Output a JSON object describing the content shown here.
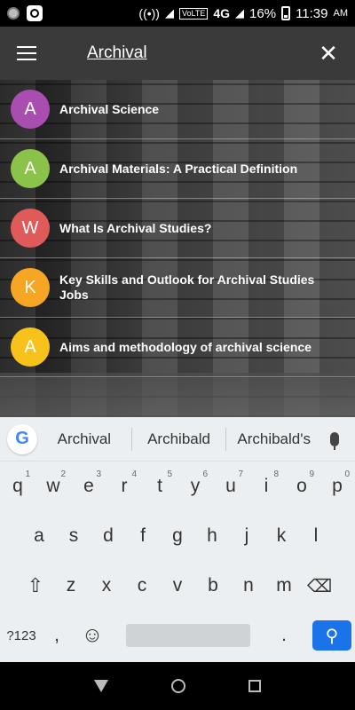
{
  "status_bar": {
    "volte": "VoLTE",
    "network": "4G",
    "network_sub": "4G",
    "battery": "16%",
    "time": "11:39",
    "ampm": "AM"
  },
  "toolbar": {
    "query": "Archival",
    "close_symbol": "✕",
    "menu_icon": "hamburger-icon"
  },
  "results": [
    {
      "letter": "A",
      "title": "Archival Science",
      "color": "#a94db0"
    },
    {
      "letter": "A",
      "title": "Archival Materials: A Practical Definition",
      "color": "#8bc34a"
    },
    {
      "letter": "W",
      "title": "What Is Archival Studies?",
      "color": "#e05a5a"
    },
    {
      "letter": "K",
      "title": "Key Skills and Outlook for Archival Studies Jobs",
      "color": "#f6a623"
    },
    {
      "letter": "A",
      "title": "Aims and methodology of archival science",
      "color": "#f7c31a"
    }
  ],
  "keyboard": {
    "google_letter": "G",
    "suggestions": [
      "Archival",
      "Archibald",
      "Archibald's"
    ],
    "row1": [
      [
        "q",
        "1"
      ],
      [
        "w",
        "2"
      ],
      [
        "e",
        "3"
      ],
      [
        "r",
        "4"
      ],
      [
        "t",
        "5"
      ],
      [
        "y",
        "6"
      ],
      [
        "u",
        "7"
      ],
      [
        "i",
        "8"
      ],
      [
        "o",
        "9"
      ],
      [
        "p",
        "0"
      ]
    ],
    "row2": [
      "a",
      "s",
      "d",
      "f",
      "g",
      "h",
      "j",
      "k",
      "l"
    ],
    "row3": [
      "z",
      "x",
      "c",
      "v",
      "b",
      "n",
      "m"
    ],
    "symbols_key": "?123",
    "comma": ",",
    "emoji": "☺",
    "period": ".",
    "shift": "⇧",
    "backspace": "⌫",
    "search_symbol": "🔍"
  }
}
